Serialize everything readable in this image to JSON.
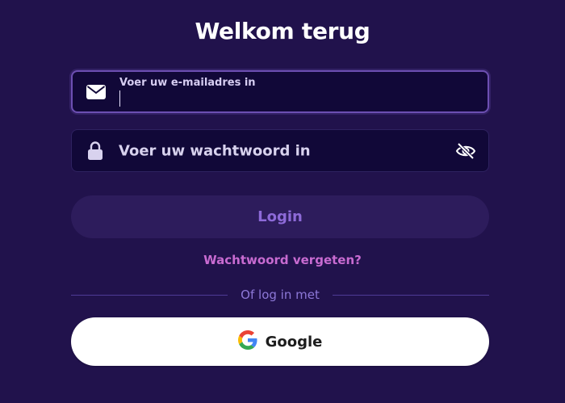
{
  "title": "Welkom terug",
  "email": {
    "label": "Voer uw e-mailadres in",
    "value": "",
    "icon": "envelope-icon"
  },
  "password": {
    "placeholder": "Voer uw wachtwoord in",
    "value": "",
    "icon": "lock-icon",
    "toggle_icon": "eye-slash-icon"
  },
  "login_button": "Login",
  "forgot_link": "Wachtwoord vergeten?",
  "divider_text": "Of log in met",
  "google_button": {
    "label": "Google",
    "icon": "google-logo-icon"
  },
  "colors": {
    "background": "#21124c",
    "field_bg": "#110838",
    "accent": "#8d6ad8",
    "link": "#c86bd1",
    "focus_border": "#6c4fb2"
  }
}
